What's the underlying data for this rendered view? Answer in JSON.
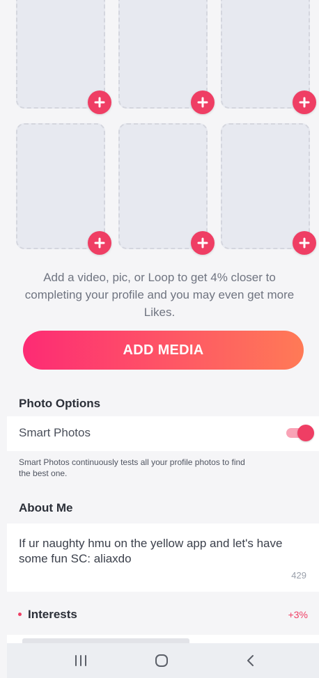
{
  "media_grid": {
    "slot_count": 6,
    "add_icon": "plus-icon"
  },
  "helper_text": "Add a video, pic, or Loop to get 4% closer to completing your profile and you may even get more Likes.",
  "add_media_button": "ADD MEDIA",
  "photo_options": {
    "title": "Photo Options",
    "smart_photos_label": "Smart Photos",
    "smart_photos_enabled": true,
    "smart_photos_description": "Smart Photos continuously tests all your profile photos to find the best one."
  },
  "about_me": {
    "title": "About Me",
    "text": "If ur naughty hmu on the yellow app and let's have some fun SC: aliaxdo",
    "remaining_chars": "429"
  },
  "interests": {
    "label": "Interests",
    "delta": "+3%"
  },
  "nav_bar": {
    "recent_icon": "recent-apps-icon",
    "home_icon": "home-icon",
    "back_icon": "back-icon"
  },
  "colors": {
    "accent": "#ef3e64",
    "gradient_start": "#fd2b74",
    "gradient_end": "#ff7a56",
    "background": "#f5f5f7"
  }
}
